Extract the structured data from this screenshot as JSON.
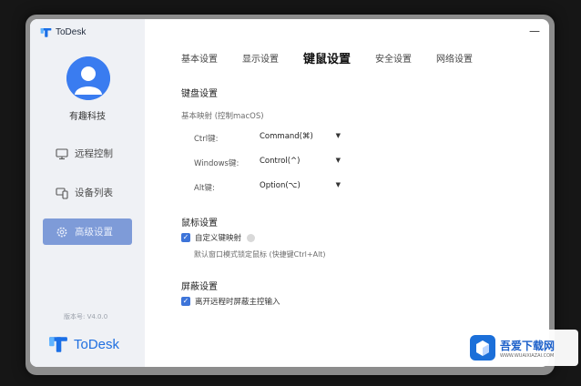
{
  "app": {
    "name": "ToDesk"
  },
  "window": {
    "minimize_glyph": "—",
    "close_glyph": "✕"
  },
  "sidebar": {
    "username": "有趣科技",
    "items": [
      {
        "label": "远程控制",
        "icon": "monitor-icon",
        "active": false
      },
      {
        "label": "设备列表",
        "icon": "device-list-icon",
        "active": false
      },
      {
        "label": "高级设置",
        "icon": "gear-icon",
        "active": true
      }
    ],
    "version": "版本号: V4.0.0",
    "brand": "ToDesk"
  },
  "tabs": [
    {
      "label": "基本设置",
      "active": false
    },
    {
      "label": "显示设置",
      "active": false
    },
    {
      "label": "键鼠设置",
      "active": true
    },
    {
      "label": "安全设置",
      "active": false
    },
    {
      "label": "网络设置",
      "active": false
    }
  ],
  "keyboard": {
    "title": "键盘设置",
    "subtitle": "基本映射 (控制macOS)",
    "mappings": [
      {
        "key": "Ctrl键:",
        "value": "Command(⌘)"
      },
      {
        "key": "Windows键:",
        "value": "Control(^)"
      },
      {
        "key": "Alt键:",
        "value": "Option(⌥)"
      }
    ]
  },
  "mouse": {
    "title": "鼠标设置",
    "checkbox_label": "自定义键映射",
    "checked": true,
    "hint": "默认窗口模式锁定鼠标 (快捷键Ctrl+Alt)"
  },
  "screen": {
    "title": "屏蔽设置",
    "checkbox_label": "离开远程时屏蔽主控输入",
    "checked": true
  },
  "watermark": {
    "title": "吾爱下载网",
    "url": "WWW.WUAIXIAZAI.COM"
  },
  "colors": {
    "accent": "#3d74d9",
    "nav_active": "#7e9bd8",
    "brand": "#1f6fe0"
  }
}
